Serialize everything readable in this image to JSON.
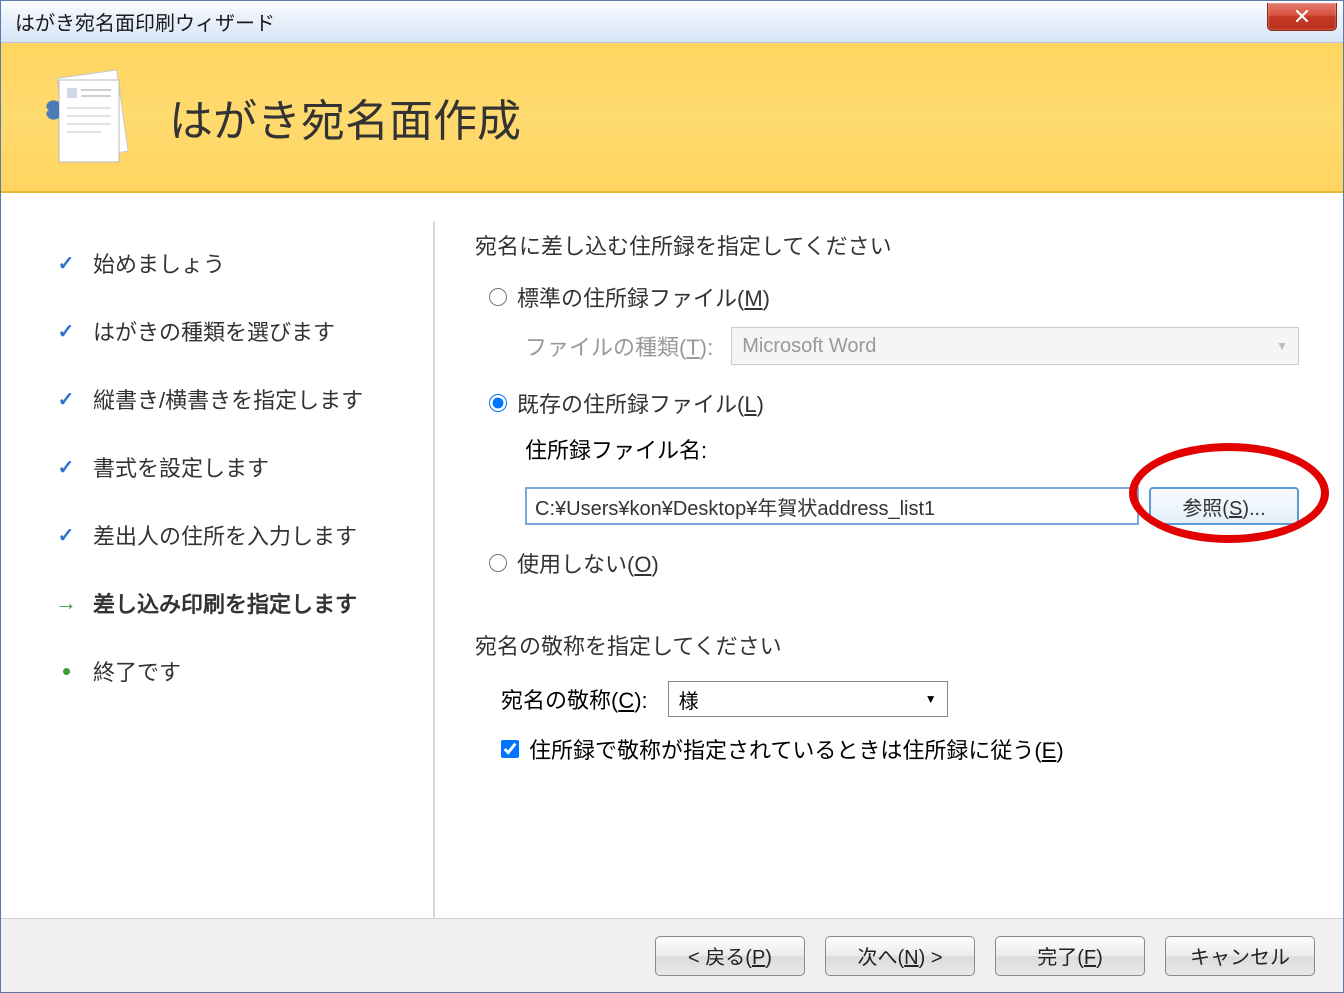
{
  "window": {
    "title": "はがき宛名面印刷ウィザード"
  },
  "header": {
    "title": "はがき宛名面作成"
  },
  "steps": [
    {
      "label": "始めましょう",
      "state": "done"
    },
    {
      "label": "はがきの種類を選びます",
      "state": "done"
    },
    {
      "label": "縦書き/横書きを指定します",
      "state": "done"
    },
    {
      "label": "書式を設定します",
      "state": "done"
    },
    {
      "label": "差出人の住所を入力します",
      "state": "done"
    },
    {
      "label": "差し込み印刷を指定します",
      "state": "current"
    },
    {
      "label": "終了です",
      "state": "pending"
    }
  ],
  "main": {
    "section1_title": "宛名に差し込む住所録を指定してください",
    "radio_standard": "標準の住所録ファイル(M)",
    "file_type_label": "ファイルの種類(T):",
    "file_type_value": "Microsoft Word",
    "radio_existing": "既存の住所録ファイル(L)",
    "file_name_label": "住所録ファイル名:",
    "file_path": "C:¥Users¥kon¥Desktop¥年賀状address_list1",
    "browse_button": "参照(S)...",
    "radio_none": "使用しない(O)",
    "section2_title": "宛名の敬称を指定してください",
    "honorific_label": "宛名の敬称(C):",
    "honorific_value": "様",
    "checkbox_label": "住所録で敬称が指定されているときは住所録に従う(E)"
  },
  "footer": {
    "back": "< 戻る(P)",
    "next": "次へ(N) >",
    "finish": "完了(F)",
    "cancel": "キャンセル"
  }
}
